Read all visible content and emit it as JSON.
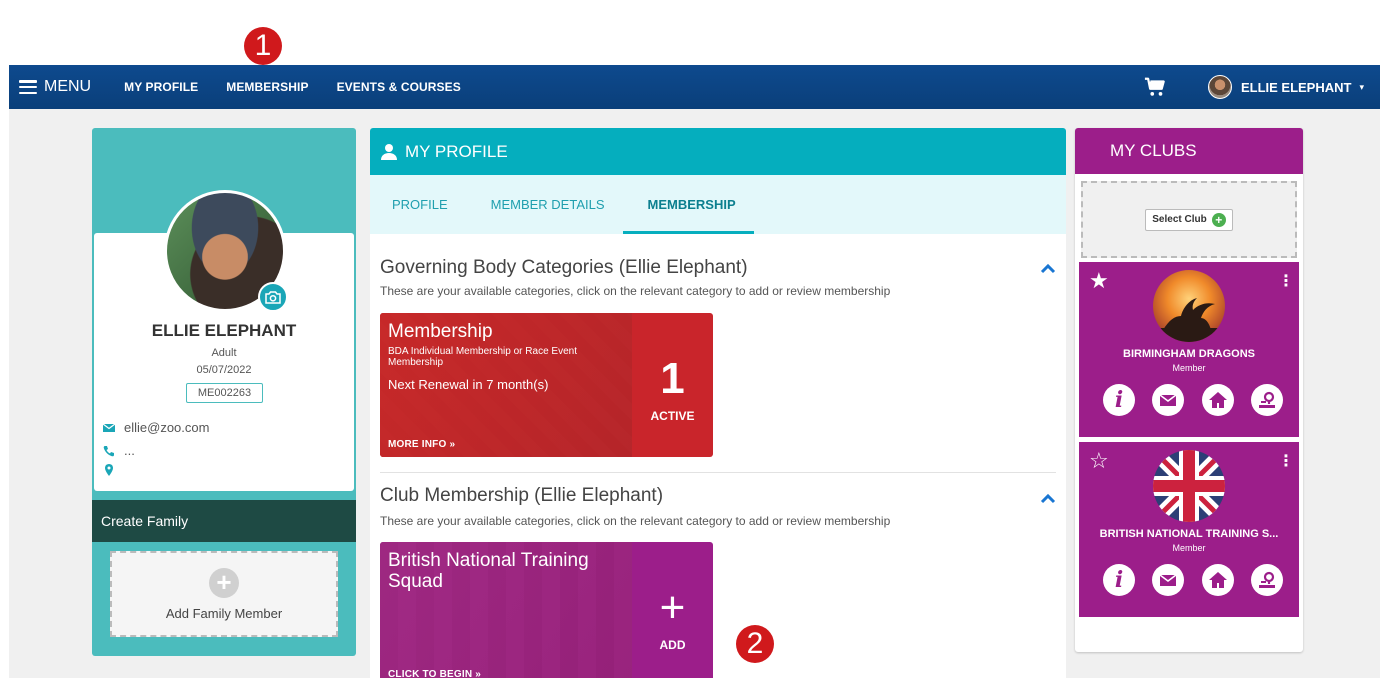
{
  "callouts": {
    "one": "1",
    "two": "2"
  },
  "nav": {
    "menu_label": "MENU",
    "links": [
      "MY PROFILE",
      "MEMBERSHIP",
      "EVENTS & COURSES"
    ],
    "user_name": "ELLIE ELEPHANT",
    "caret": "▾"
  },
  "profile": {
    "name": "ELLIE ELEPHANT",
    "type": "Adult",
    "date": "05/07/2022",
    "member_id": "ME002263",
    "email": "ellie@zoo.com",
    "phone": "...",
    "location": ""
  },
  "family": {
    "create_label": "Create Family",
    "add_label": "Add Family Member",
    "plus": "+"
  },
  "main": {
    "header_title": "MY PROFILE",
    "tabs": [
      {
        "label": "PROFILE",
        "active": false
      },
      {
        "label": "MEMBER DETAILS",
        "active": false
      },
      {
        "label": "MEMBERSHIP",
        "active": true
      }
    ],
    "governing": {
      "title": "Governing Body Categories (Ellie Elephant)",
      "subtitle": "These are your available categories, click on the relevant category to add or review membership",
      "card": {
        "title": "Membership",
        "description": "BDA Individual Membership or Race Event Membership",
        "renewal": "Next Renewal in 7 month(s)",
        "link": "MORE INFO",
        "count": "1",
        "status": "ACTIVE"
      }
    },
    "club": {
      "title": "Club Membership (Ellie Elephant)",
      "subtitle": "These are your available categories, click on the relevant category to add or review membership",
      "card": {
        "title": "British National Training Squad",
        "link": "CLICK TO BEGIN",
        "plus": "+",
        "status": "ADD"
      }
    }
  },
  "clubs": {
    "header": "MY CLUBS",
    "select_label": "Select Club",
    "select_plus": "+",
    "items": [
      {
        "name": "BIRMINGHAM DRAGONS",
        "role": "Member",
        "favorite": true,
        "star": "★",
        "kebab": "⋮",
        "info": "i"
      },
      {
        "name": "BRITISH NATIONAL TRAINING S...",
        "role": "Member",
        "favorite": false,
        "star": "☆",
        "kebab": "⋮",
        "info": "i"
      }
    ]
  },
  "colors": {
    "nav": "#0e4a8e",
    "teal": "#4bbcbd",
    "header_teal": "#05aebe",
    "red_card": "#c9252b",
    "purple": "#9c1e8a",
    "callout": "#d0191c"
  }
}
